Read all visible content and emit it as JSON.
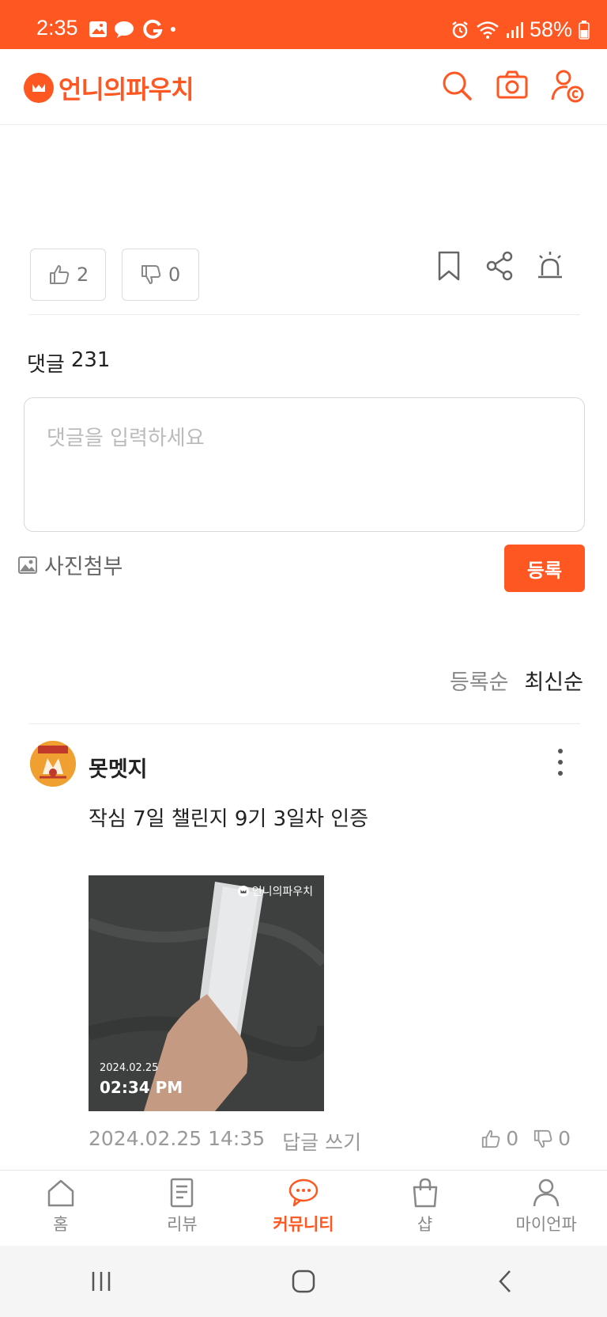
{
  "status_bar": {
    "time": "2:35",
    "battery": "58%",
    "icons": [
      "image-icon",
      "chat-bubble-icon",
      "g-icon",
      "dot-icon",
      "alarm-icon",
      "wifi-icon",
      "signal-icon",
      "battery-icon"
    ]
  },
  "header": {
    "logo_text": "언니의파우치",
    "icons": [
      "search-icon",
      "camera-icon",
      "user-coin-icon"
    ]
  },
  "post_actions": {
    "likes": "2",
    "dislikes": "0",
    "icons": [
      "bookmark-icon",
      "share-icon",
      "alert-icon"
    ]
  },
  "comments_section": {
    "label": "댓글",
    "count": "231",
    "input_placeholder": "댓글을 입력하세요",
    "photo_attach_label": "사진첨부",
    "submit_label": "등록",
    "sort": {
      "by_registration": "등록순",
      "by_latest": "최신순",
      "selected": "최신순"
    }
  },
  "comment": {
    "author": "못멧지",
    "text": "작심 7일 챌린지 9기 3일차 인증",
    "photo": {
      "watermark": "언니의파우치",
      "date": "2024.02.25",
      "time": "02:34 PM"
    },
    "timestamp": "2024.02.25 14:35",
    "reply_label": "답글 쓰기",
    "likes": "0",
    "dislikes": "0"
  },
  "bottom_nav": {
    "items": [
      {
        "label": "홈",
        "icon": "home-icon"
      },
      {
        "label": "리뷰",
        "icon": "review-icon"
      },
      {
        "label": "커뮤니티",
        "icon": "community-icon"
      },
      {
        "label": "샵",
        "icon": "shop-icon"
      },
      {
        "label": "마이언파",
        "icon": "profile-icon"
      }
    ],
    "active": "커뮤니티"
  },
  "colors": {
    "accent": "#ff5722",
    "text": "#222222",
    "muted": "#888888"
  }
}
